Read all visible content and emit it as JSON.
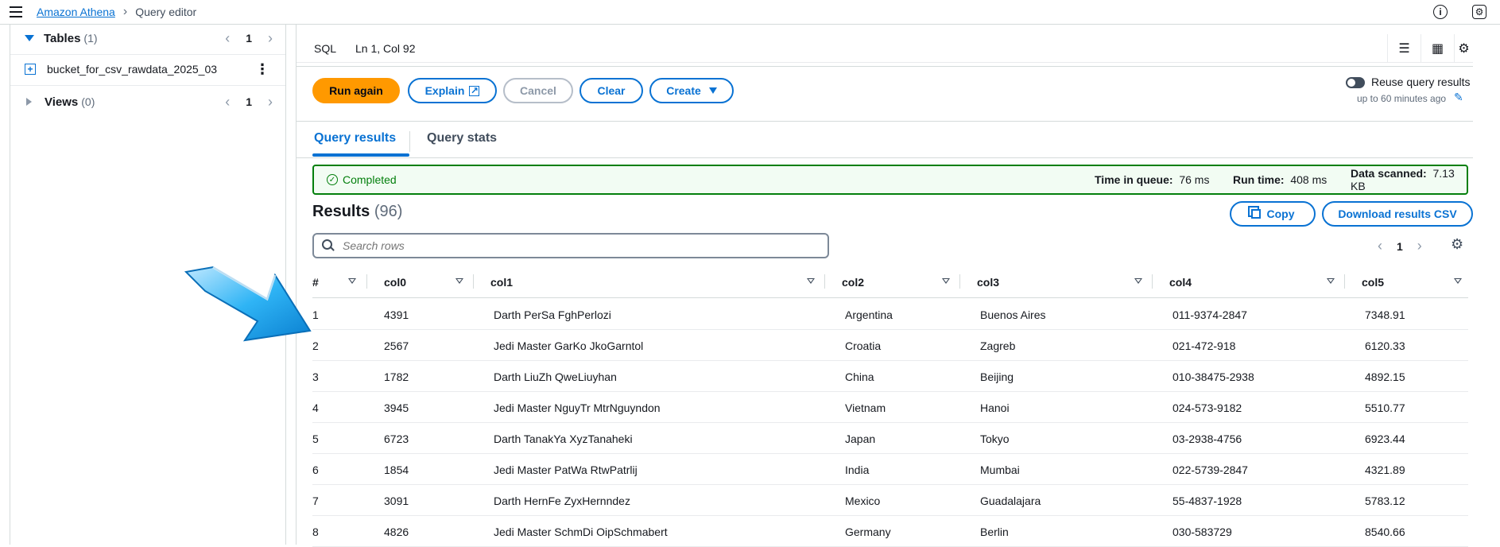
{
  "header": {
    "breadcrumb_root": "Amazon Athena",
    "breadcrumb_current": "Query editor"
  },
  "sidebar": {
    "tables": {
      "title": "Tables",
      "count": "(1)",
      "page": "1"
    },
    "table_items": [
      {
        "label": "bucket_for_csv_rawdata_2025_03"
      }
    ],
    "views": {
      "title": "Views",
      "count": "(0)",
      "page": "1"
    }
  },
  "editor": {
    "language": "SQL",
    "cursor_position": "Ln 1, Col 92"
  },
  "actions": {
    "run_again": "Run again",
    "explain": "Explain",
    "cancel": "Cancel",
    "clear": "Clear",
    "create": "Create",
    "reuse_label": "Reuse query results",
    "reuse_sub": "up to 60 minutes ago",
    "reuse_enabled": false
  },
  "tabs": [
    {
      "label": "Query results",
      "active": true
    },
    {
      "label": "Query stats",
      "active": false
    }
  ],
  "status": {
    "text": "Completed",
    "queue_label": "Time in queue:",
    "queue_value": "76 ms",
    "runtime_label": "Run time:",
    "runtime_value": "408 ms",
    "scanned_label": "Data scanned:",
    "scanned_value": "7.13 KB"
  },
  "results": {
    "title": "Results",
    "count": "(96)",
    "copy_label": "Copy",
    "download_label": "Download results CSV",
    "search_placeholder": "Search rows",
    "page": "1",
    "columns": [
      "#",
      "col0",
      "col1",
      "col2",
      "col3",
      "col4",
      "col5"
    ],
    "rows": [
      [
        "1",
        "4391",
        "Darth PerSa FghPerlozi",
        "Argentina",
        "Buenos Aires",
        "011-9374-2847",
        "7348.91"
      ],
      [
        "2",
        "2567",
        "Jedi Master GarKo JkoGarntol",
        "Croatia",
        "Zagreb",
        "021-472-918",
        "6120.33"
      ],
      [
        "3",
        "1782",
        "Darth LiuZh QweLiuyhan",
        "China",
        "Beijing",
        "010-38475-2938",
        "4892.15"
      ],
      [
        "4",
        "3945",
        "Jedi Master NguyTr MtrNguyndon",
        "Vietnam",
        "Hanoi",
        "024-573-9182",
        "5510.77"
      ],
      [
        "5",
        "6723",
        "Darth TanakYa XyzTanaheki",
        "Japan",
        "Tokyo",
        "03-2938-4756",
        "6923.44"
      ],
      [
        "6",
        "1854",
        "Jedi Master PatWa RtwPatrlij",
        "India",
        "Mumbai",
        "022-5739-2847",
        "4321.89"
      ],
      [
        "7",
        "3091",
        "Darth HernFe ZyxHernndez",
        "Mexico",
        "Guadalajara",
        "55-4837-1928",
        "5783.12"
      ],
      [
        "8",
        "4826",
        "Jedi Master SchmDi OipSchmabert",
        "Germany",
        "Berlin",
        "030-583729",
        "8540.66"
      ]
    ]
  },
  "colors": {
    "primary": "#ff9900",
    "link": "#0972d3",
    "success": "#037f0c",
    "arrow_overlay": "#2fb4f5"
  }
}
